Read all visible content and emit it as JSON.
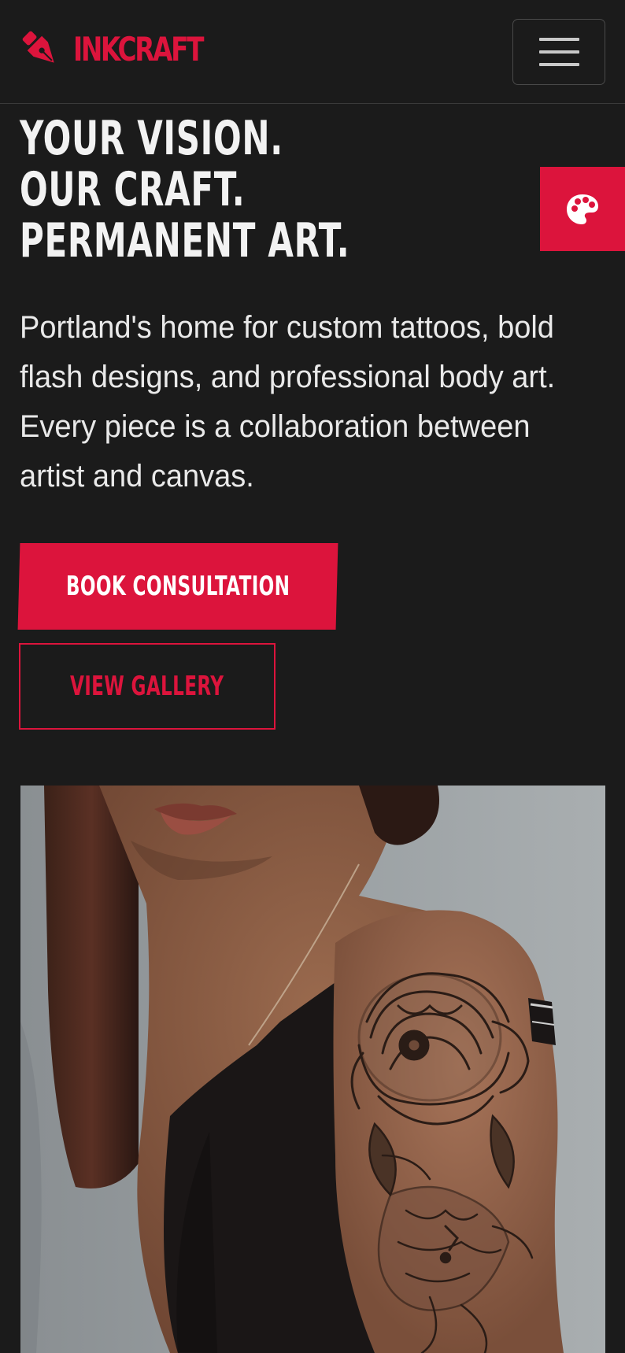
{
  "header": {
    "brand_name": "INKCRAFT",
    "brand_icon": "pen-nib-icon",
    "menu_icon": "hamburger-menu-icon"
  },
  "hero": {
    "title_lines": [
      "YOUR VISION.",
      "OUR CRAFT.",
      "PERMANENT ART."
    ],
    "description": "Portland's home for custom tattoos, bold flash designs, and professional body art. Every piece is a collaboration between artist and canvas.",
    "primary_button": "BOOK CONSULTATION",
    "secondary_button": "VIEW GALLERY"
  },
  "theme_button": {
    "icon": "palette-icon"
  },
  "hero_image": {
    "icon": "tattooed-arm-photo"
  },
  "colors": {
    "background": "#1b1b1b",
    "accent": "#dc143c",
    "text": "#f2f2f2",
    "border": "#3a3a3a"
  }
}
